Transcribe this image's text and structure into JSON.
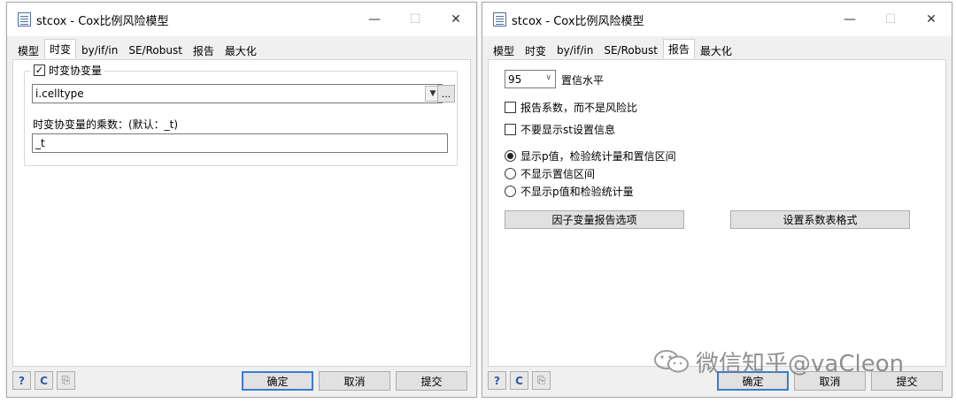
{
  "left_window": {
    "title": "stcox - Cox比例风险模型",
    "tabs": [
      {
        "label": "模型"
      },
      {
        "label": "时变"
      },
      {
        "label": "by/if/in"
      },
      {
        "label": "SE/Robust"
      },
      {
        "label": "报告"
      },
      {
        "label": "最大化"
      }
    ],
    "active_tab": "时变",
    "group": {
      "checkbox_label": "时变协变量",
      "checked": true,
      "varlist_value": "i.celltype",
      "browse_label": "...",
      "multiplier_label": "时变协变量的乘数：(默认：_t)",
      "multiplier_value": "_t"
    }
  },
  "right_window": {
    "title": "stcox - Cox比例风险模型",
    "tabs": [
      {
        "label": "模型"
      },
      {
        "label": "时变"
      },
      {
        "label": "by/if/in"
      },
      {
        "label": "SE/Robust"
      },
      {
        "label": "报告"
      },
      {
        "label": "最大化"
      }
    ],
    "active_tab": "报告",
    "confidence_value": "95",
    "confidence_label": "置信水平",
    "checkboxes": [
      {
        "label": "报告系数，而不是风险比",
        "checked": false
      },
      {
        "label": "不要显示st设置信息",
        "checked": false
      }
    ],
    "radios": [
      {
        "label": "显示p值，检验统计量和置信区间",
        "checked": true
      },
      {
        "label": "不显示置信区间",
        "checked": false
      },
      {
        "label": "不显示p值和检验统计量",
        "checked": false
      }
    ],
    "factor_button": "因子变量报告选项",
    "coef_button": "设置系数表格式"
  },
  "footer": {
    "help_icon": "?",
    "reset_icon": "C",
    "ok_label": "确定",
    "cancel_label": "取消",
    "submit_label": "提交"
  },
  "window_controls": {
    "minimize": "—",
    "maximize": "☐",
    "close": "✕"
  },
  "watermark": {
    "text": "微信知乎@vaCleon"
  },
  "colors": {
    "default_button_border": "#3a7bd5",
    "icon_blue": "#2a5aa8"
  }
}
